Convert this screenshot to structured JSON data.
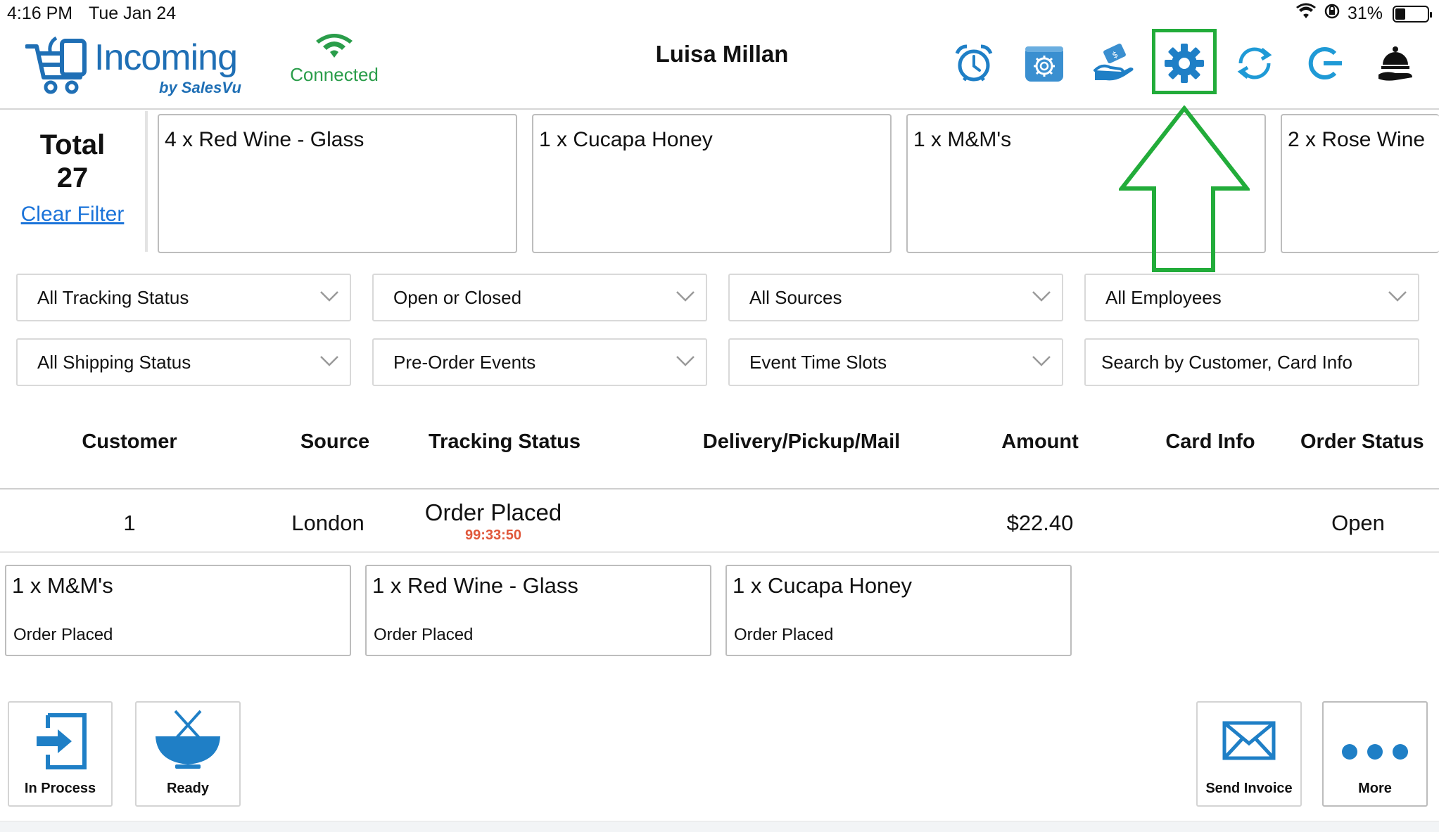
{
  "status_bar": {
    "time": "4:16 PM",
    "date": "Tue Jan 24",
    "battery": "31%",
    "battery_level": 0.31
  },
  "header": {
    "app_name": "Incoming",
    "app_byline": "by SalesVu",
    "connection_status": "Connected",
    "user_name": "Luisa Millan",
    "icons": [
      "alarm-clock-icon",
      "register-settings-icon",
      "hand-money-icon",
      "gear-icon",
      "refresh-icon",
      "logout-icon",
      "service-bell-icon"
    ]
  },
  "summary": {
    "total_label": "Total",
    "total_value": "27",
    "clear_filter": "Clear Filter"
  },
  "product_totals": [
    "4 x Red Wine - Glass",
    "1 x Cucapa Honey",
    "1 x M&M's",
    "2 x Rose Wine"
  ],
  "filters": {
    "row1": [
      "All Tracking Status",
      "Open or Closed",
      "All Sources",
      "All Employees"
    ],
    "row2": [
      "All Shipping Status",
      "Pre-Order Events",
      "Event Time Slots"
    ],
    "search_placeholder": "Search by Customer, Card Info"
  },
  "table": {
    "columns": [
      "Customer",
      "Source",
      "Tracking Status",
      "Delivery/Pickup/Mail",
      "Amount",
      "Card Info",
      "Order Status"
    ],
    "rows": [
      {
        "customer": "1",
        "source": "London",
        "tracking_status": "Order Placed",
        "timer": "99:33:50",
        "delivery": "",
        "amount": "$22.40",
        "card_info": "",
        "order_status": "Open"
      }
    ]
  },
  "order_items": [
    {
      "name": "1 x M&M's",
      "status": "Order Placed"
    },
    {
      "name": "1 x Red Wine - Glass",
      "status": "Order Placed"
    },
    {
      "name": "1 x Cucapa Honey",
      "status": "Order Placed"
    }
  ],
  "actions": {
    "in_process": "In Process",
    "ready": "Ready",
    "send_invoice": "Send Invoice",
    "more": "More"
  },
  "colors": {
    "brand_blue": "#1f6fb5",
    "connected_green": "#2a9d4a",
    "highlight_green": "#22ac3a",
    "timer_red": "#e0573a",
    "link_blue": "#1a73d9"
  }
}
